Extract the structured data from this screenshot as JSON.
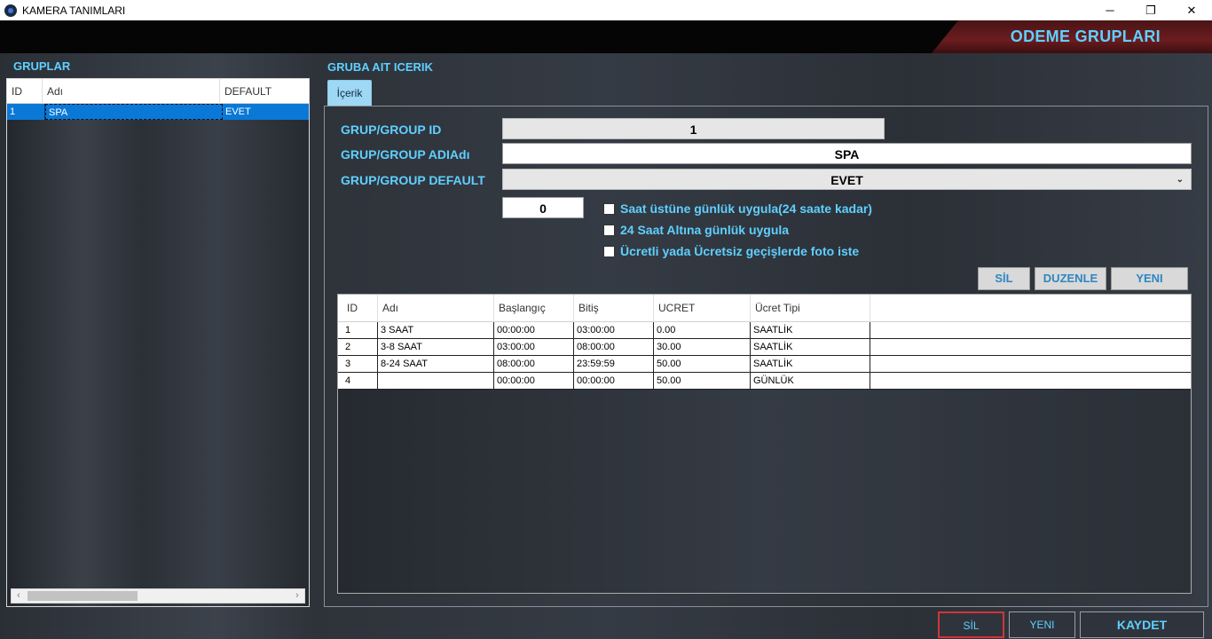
{
  "window": {
    "title": "KAMERA TANIMLARI",
    "controls": {
      "minimize": "─",
      "restore": "❐",
      "close": "✕"
    }
  },
  "header": {
    "title": "ODEME GRUPLARI"
  },
  "left": {
    "label": "GRUPLAR",
    "columns": [
      "ID",
      "Adı",
      "DEFAULT"
    ],
    "rows": [
      {
        "id": "1",
        "name": "SPA",
        "default": "EVET"
      }
    ]
  },
  "right": {
    "label": "GRUBA AIT ICERIK",
    "tab": "İçerik",
    "fields": {
      "group_id_label": "GRUP/GROUP ID",
      "group_id_value": "1",
      "group_name_label": "GRUP/GROUP ADIAdı",
      "group_name_value": "SPA",
      "group_default_label": "GRUP/GROUP DEFAULT",
      "group_default_value": "EVET",
      "number_value": "0"
    },
    "checkboxes": [
      {
        "label": "Saat üstüne günlük uygula(24 saate kadar)",
        "checked": false
      },
      {
        "label": "24 Saat Altına günlük uygula",
        "checked": false
      },
      {
        "label": "Ücretli yada Ücretsiz geçişlerde foto iste",
        "checked": false
      }
    ],
    "buttons": {
      "sil": "SİL",
      "duzenle": "DUZENLE",
      "yeni": "YENI"
    },
    "grid": {
      "columns": [
        "ID",
        "Adı",
        "Başlangıç",
        "Bitiş",
        "UCRET",
        "Ücret Tipi"
      ],
      "rows": [
        [
          "1",
          "3 SAAT",
          "00:00:00",
          "03:00:00",
          "0.00",
          "SAATLİK"
        ],
        [
          "2",
          "3-8 SAAT",
          "03:00:00",
          "08:00:00",
          "30.00",
          "SAATLİK"
        ],
        [
          "3",
          "8-24 SAAT",
          "08:00:00",
          "23:59:59",
          "50.00",
          "SAATLİK"
        ],
        [
          "4",
          "",
          "00:00:00",
          "00:00:00",
          "50.00",
          "GÜNLÜK"
        ]
      ]
    }
  },
  "footer": {
    "sil": "SİL",
    "yeni": "YENI",
    "kaydet": "KAYDET"
  },
  "colors": {
    "accent": "#5fd0ff",
    "selection": "#0a78d7",
    "danger": "#d0363a",
    "header_red": "#6b1c1f"
  }
}
